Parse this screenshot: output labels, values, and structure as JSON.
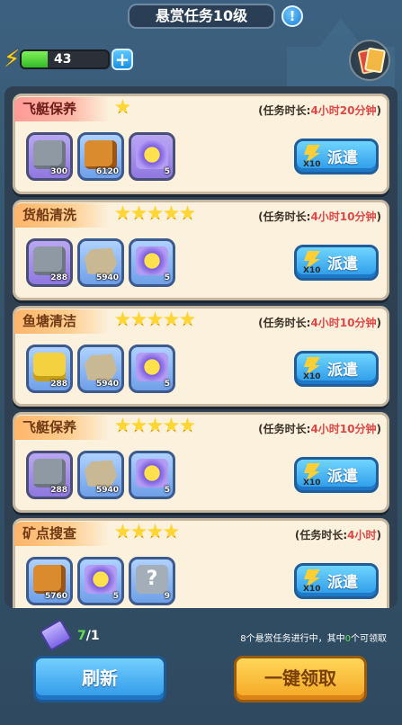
{
  "header": {
    "title": "悬赏任务10级",
    "info_label": "!",
    "energy_value": "43",
    "energy_fill_fraction": 0.3,
    "plus_label": "+"
  },
  "tasks": [
    {
      "name": "飞艇保养",
      "tab_color": "red",
      "stars": 1,
      "duration_label": "(任务时长:",
      "duration_value": "4小时20分钟",
      "duration_close": ")",
      "items": [
        {
          "icon": "stone-icon",
          "style": "purple",
          "count": "300"
        },
        {
          "icon": "log-icon",
          "style": "blue",
          "count": "6120"
        },
        {
          "icon": "energy-token-icon",
          "style": "purple",
          "count": "5"
        }
      ],
      "dispatch_multiplier": "X10",
      "dispatch_label": "派遣"
    },
    {
      "name": "货船清洗",
      "tab_color": "orange",
      "stars": 5,
      "duration_label": "(任务时长:",
      "duration_value": "4小时10分钟",
      "duration_close": ")",
      "items": [
        {
          "icon": "ore-icon",
          "style": "purple",
          "count": "288"
        },
        {
          "icon": "stone-block-icon",
          "style": "blue",
          "count": "5940"
        },
        {
          "icon": "energy-token-icon",
          "style": "blue",
          "count": "5"
        }
      ],
      "dispatch_multiplier": "X10",
      "dispatch_label": "派遣"
    },
    {
      "name": "鱼塘清洁",
      "tab_color": "orange",
      "stars": 5,
      "duration_label": "(任务时长:",
      "duration_value": "4小时10分钟",
      "duration_close": ")",
      "items": [
        {
          "icon": "hay-icon",
          "style": "blue",
          "count": "288"
        },
        {
          "icon": "stone-block-icon",
          "style": "blue",
          "count": "5940"
        },
        {
          "icon": "energy-token-icon",
          "style": "blue",
          "count": "5"
        }
      ],
      "dispatch_multiplier": "X10",
      "dispatch_label": "派遣"
    },
    {
      "name": "飞艇保养",
      "tab_color": "orange",
      "stars": 5,
      "duration_label": "(任务时长:",
      "duration_value": "4小时10分钟",
      "duration_close": ")",
      "items": [
        {
          "icon": "stone-icon",
          "style": "purple",
          "count": "288"
        },
        {
          "icon": "stone-block-icon",
          "style": "blue",
          "count": "5940"
        },
        {
          "icon": "energy-token-icon",
          "style": "blue",
          "count": "5"
        }
      ],
      "dispatch_multiplier": "X10",
      "dispatch_label": "派遣"
    },
    {
      "name": "矿点搜查",
      "tab_color": "orange",
      "stars": 4,
      "duration_label": "(任务时长:",
      "duration_value": "4小时",
      "duration_close": ")",
      "items": [
        {
          "icon": "log-icon",
          "style": "blue",
          "count": "5760"
        },
        {
          "icon": "energy-token-icon",
          "style": "blue",
          "count": "5"
        },
        {
          "icon": "mystery-scroll-icon",
          "style": "blue",
          "count": "9"
        }
      ],
      "dispatch_multiplier": "X10",
      "dispatch_label": "派遣"
    }
  ],
  "footer": {
    "ticket_current": "7",
    "ticket_total": "/1",
    "status_prefix": "8个悬赏任务进行中，其中",
    "status_count": "0",
    "status_suffix": "个可领取",
    "refresh_label": "刷新",
    "claim_all_label": "一键领取"
  }
}
